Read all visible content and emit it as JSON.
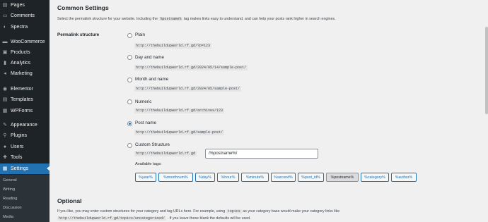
{
  "sidebar": {
    "items": [
      {
        "label": "Pages",
        "icon": "pages-icon",
        "glyph": "▤"
      },
      {
        "label": "Comments",
        "icon": "comments-icon",
        "glyph": "▭"
      },
      {
        "label": "Spectra",
        "icon": "spectra-icon",
        "glyph": "◐"
      },
      {
        "label": "WooCommerce",
        "icon": "woocommerce-icon",
        "glyph": "▬"
      },
      {
        "label": "Products",
        "icon": "products-icon",
        "glyph": "▣"
      },
      {
        "label": "Analytics",
        "icon": "analytics-icon",
        "glyph": "▮"
      },
      {
        "label": "Marketing",
        "icon": "marketing-icon",
        "glyph": "◂"
      },
      {
        "label": "Elementor",
        "icon": "elementor-icon",
        "glyph": "◉"
      },
      {
        "label": "Templates",
        "icon": "templates-icon",
        "glyph": "▤"
      },
      {
        "label": "WPForms",
        "icon": "wpforms-icon",
        "glyph": "▦"
      },
      {
        "label": "Appearance",
        "icon": "appearance-icon",
        "glyph": "✎"
      },
      {
        "label": "Plugins",
        "icon": "plugins-icon",
        "glyph": "⚲"
      },
      {
        "label": "Users",
        "icon": "users-icon",
        "glyph": "●"
      },
      {
        "label": "Tools",
        "icon": "tools-icon",
        "glyph": "✚"
      },
      {
        "label": "Settings",
        "icon": "settings-icon",
        "glyph": "▦"
      }
    ],
    "active_index": 14,
    "submenu": [
      "General",
      "Writing",
      "Reading",
      "Discussion",
      "Media"
    ]
  },
  "common": {
    "title": "Common Settings",
    "desc_before": "Select the permalink structure for your website. Including the",
    "desc_code": "%postname%",
    "desc_after": "tag makes links easy to understand, and can help your posts rank higher in search engines.",
    "row_label": "Permalink structure"
  },
  "options": [
    {
      "label": "Plain",
      "example": "http://thebuildupworld.rf.gd/?p=123",
      "checked": false
    },
    {
      "label": "Day and name",
      "example": "http://thebuildupworld.rf.gd/2024/05/14/sample-post/",
      "checked": false
    },
    {
      "label": "Month and name",
      "example": "http://thebuildupworld.rf.gd/2024/05/sample-post/",
      "checked": false
    },
    {
      "label": "Numeric",
      "example": "http://thebuildupworld.rf.gd/archives/123",
      "checked": false
    },
    {
      "label": "Post name",
      "example": "http://thebuildupworld.rf.gd/sample-post/",
      "checked": true
    },
    {
      "label": "Custom Structure",
      "example": "",
      "checked": false
    }
  ],
  "custom": {
    "prefix": "http://thebuildupworld.rf.gd",
    "value": "/%postname%/",
    "tags_label": "Available tags:",
    "tags": [
      "%year%",
      "%monthnum%",
      "%day%",
      "%hour%",
      "%minute%",
      "%second%",
      "%post_id%",
      "%postname%",
      "%category%",
      "%author%"
    ],
    "active_tag": "%postname%"
  },
  "optional": {
    "title": "Optional",
    "line1_before": "If you like, you may enter custom structures for your category and tag URLs here. For example, using",
    "line1_code": "topics",
    "line1_after": "as your category base would make your category links like",
    "line2_code": "http://thebuildupworld.rf.gd/topics/uncategorized/",
    "line2_after": ". If you leave these blank the defaults will be used."
  }
}
